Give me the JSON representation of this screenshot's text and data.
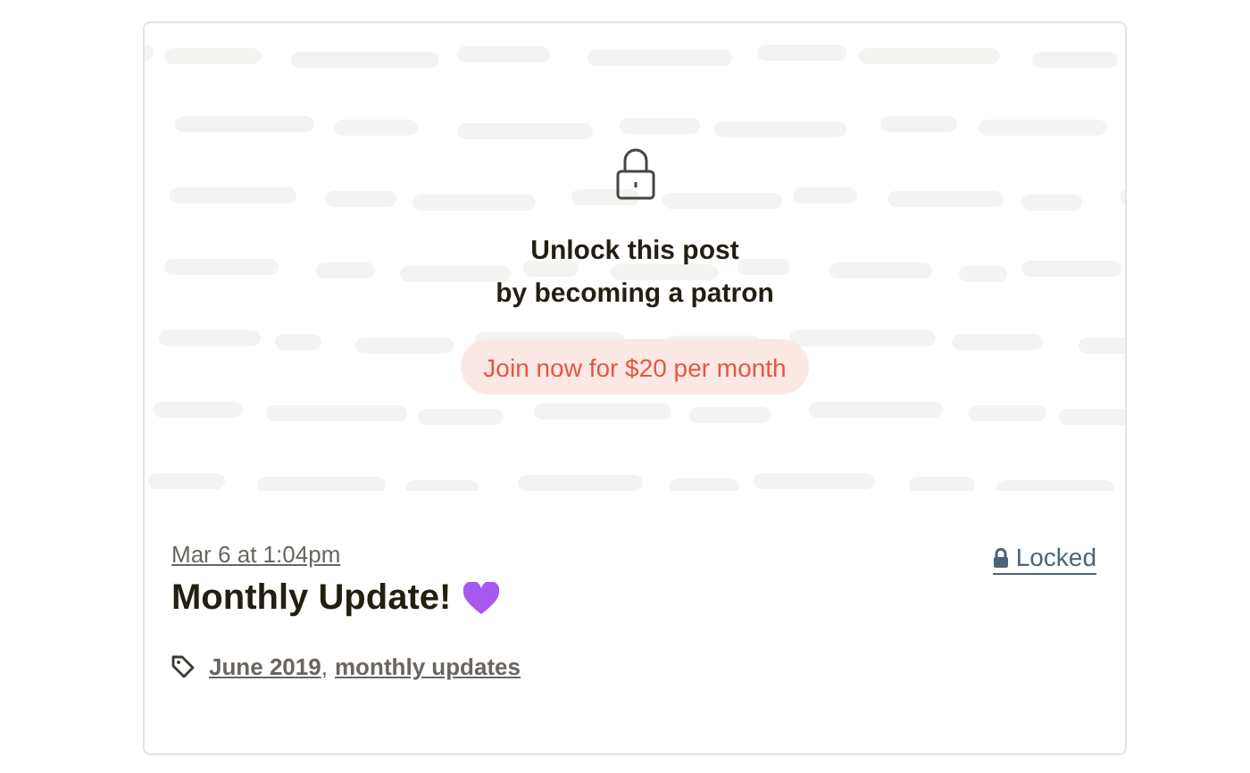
{
  "locked_preview": {
    "headline": [
      "Unlock this post",
      "by becoming a patron"
    ],
    "join_button": "Join now for $20 per month"
  },
  "post": {
    "date": "Mar 6 at 1:04pm",
    "status": "Locked",
    "locked": true,
    "title": "Monthly Update!",
    "tags": [
      {
        "label": "June 2019",
        "separator": ","
      },
      {
        "label": "monthly updates"
      }
    ]
  }
}
